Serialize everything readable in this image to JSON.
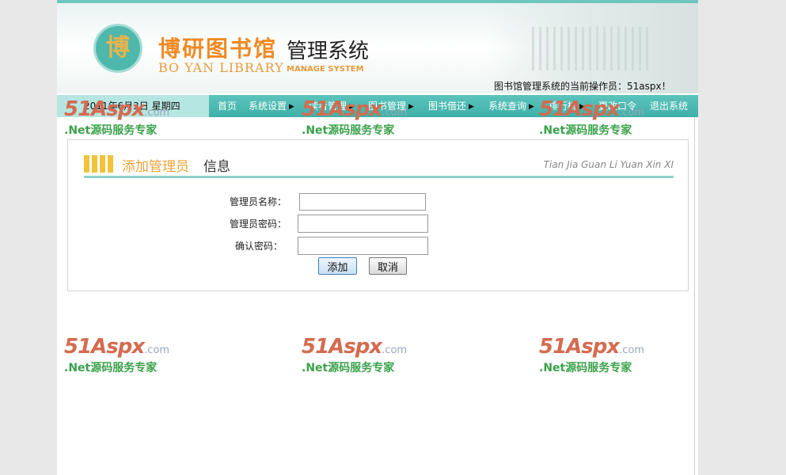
{
  "header": {
    "logo_char": "博",
    "title_cn": "博研图书馆",
    "title_mgmt": "管理系统",
    "title_en": "BO YAN LIBRARY",
    "title_en2": "MANAGE SYSTEM",
    "operator_text": "图书馆管理系统的当前操作员：51aspx！"
  },
  "nav": {
    "date": "2011年6月3日 星期四",
    "items": [
      {
        "label": "首页",
        "has_arrow": false
      },
      {
        "label": "系统设置",
        "has_arrow": true
      },
      {
        "label": "读者管理",
        "has_arrow": true
      },
      {
        "label": "图书管理",
        "has_arrow": true
      },
      {
        "label": "图书借还",
        "has_arrow": true
      },
      {
        "label": "系统查询",
        "has_arrow": true
      },
      {
        "label": "排行榜",
        "has_arrow": true
      },
      {
        "label": "更改口令",
        "has_arrow": false
      },
      {
        "label": "退出系统",
        "has_arrow": false
      }
    ]
  },
  "panel": {
    "title_highlight": "添加管理员",
    "title_rest": "信息",
    "title_pinyin": "Tian Jia Guan Li Yuan Xin XI",
    "form": {
      "name_label": "管理员名称：",
      "name_value": "",
      "password_label": "管理员密码：",
      "password_value": "",
      "confirm_label": "确认密码：",
      "confirm_value": "",
      "add_button": "添加",
      "cancel_button": "取消"
    }
  },
  "watermark": {
    "brand": "51Aspx",
    "domain": ".com",
    "slogan": ".Net源码服务专家"
  },
  "colors": {
    "nav_bg": "#46b6ae",
    "accent_orange": "#f08a24",
    "watermark_red": "#d46b50",
    "watermark_green": "#3aa24a"
  }
}
